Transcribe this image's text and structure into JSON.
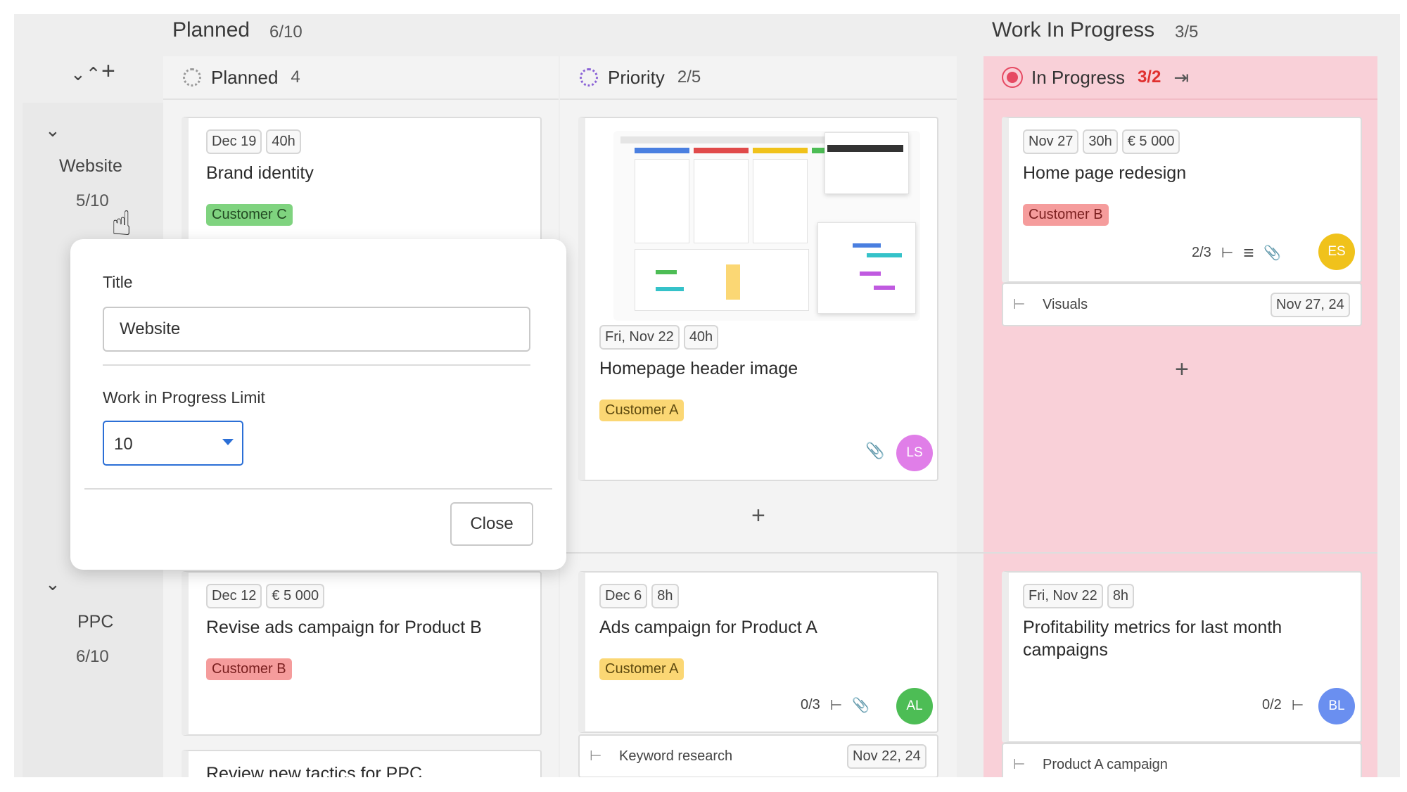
{
  "groups": {
    "planned": {
      "title": "Planned",
      "count": "6/10"
    },
    "wip": {
      "title": "Work In Progress",
      "count": "3/5"
    }
  },
  "columns": {
    "planned": {
      "title": "Planned",
      "count": "4"
    },
    "priority": {
      "title": "Priority",
      "count": "2/5"
    },
    "in_progress": {
      "title": "In Progress",
      "count": "3/2"
    }
  },
  "lanes": {
    "website": {
      "name": "Website",
      "count": "5/10"
    },
    "ppc": {
      "name": "PPC",
      "count": "6/10"
    }
  },
  "cards": {
    "brand": {
      "date": "Dec 19",
      "hours": "40h",
      "title": "Brand identity",
      "tag": "Customer C"
    },
    "homepage_img": {
      "date": "Fri, Nov 22",
      "hours": "40h",
      "title": "Homepage header image",
      "tag": "Customer A",
      "avatar": "LS"
    },
    "home_redesign": {
      "date": "Nov 27",
      "hours": "30h",
      "price": "€ 5 000",
      "title": "Home page redesign",
      "tag": "Customer B",
      "subtasks": "2/3",
      "avatar": "ES"
    },
    "revise_ads": {
      "date": "Dec 12",
      "price": "€ 5 000",
      "title": "Revise ads campaign for Product B",
      "tag": "Customer B"
    },
    "ads_a": {
      "date": "Dec 6",
      "hours": "8h",
      "title": "Ads campaign for Product A",
      "tag": "Customer A",
      "subtasks": "0/3",
      "avatar": "AL"
    },
    "profit": {
      "date": "Fri, Nov 22",
      "hours": "8h",
      "title_line1": "Profitability metrics for last month",
      "title_line2": "campaigns",
      "subtasks": "0/2",
      "avatar": "BL"
    },
    "review": {
      "title": "Review new tactics for PPC"
    }
  },
  "subtasks": {
    "visuals": {
      "label": "Visuals",
      "date": "Nov 27, 24"
    },
    "keyword": {
      "label": "Keyword research",
      "date": "Nov 22, 24"
    },
    "product_a": {
      "label": "Product A campaign"
    }
  },
  "dialog": {
    "title_label": "Title",
    "title_value": "Website",
    "wip_label": "Work in Progress Limit",
    "wip_value": "10",
    "close_label": "Close"
  },
  "colors": {
    "customer_a": "#fbd774",
    "customer_b": "#f59c9c",
    "customer_c": "#7fd37f",
    "in_progress_bg": "#f9d0d8",
    "over_limit": "#e0302f",
    "focus_blue": "#2b6fd6",
    "avatar_ls": "#e07ee8",
    "avatar_es": "#f0c21b",
    "avatar_al": "#4dbd55",
    "avatar_bl": "#6a8ff0"
  }
}
